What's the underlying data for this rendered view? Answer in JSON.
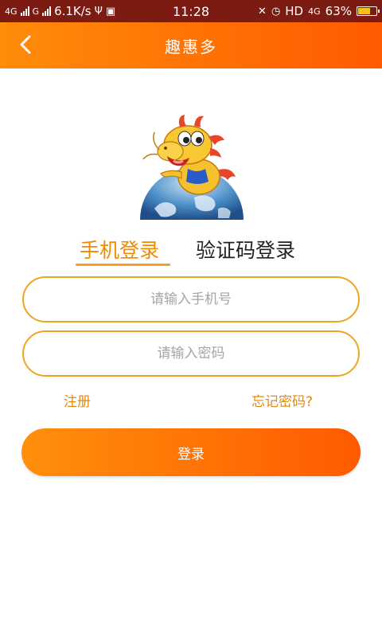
{
  "status_bar": {
    "net1": "4G",
    "net2": "G",
    "speed": "6.1K/s",
    "time": "11:28",
    "hd": "HD",
    "net3": "4G",
    "battery": "63%",
    "battery_level": 0.63
  },
  "header": {
    "title": "趣惠多"
  },
  "tabs": [
    {
      "label": "手机登录",
      "active": true
    },
    {
      "label": "验证码登录",
      "active": false
    }
  ],
  "form": {
    "phone_placeholder": "请输入手机号",
    "password_placeholder": "请输入密码"
  },
  "links": {
    "register": "注册",
    "forgot": "忘记密码?"
  },
  "login_button": "登录",
  "colors": {
    "accent": "#ff7a00",
    "status_bar": "#7b1b12",
    "border": "#efa51e"
  }
}
